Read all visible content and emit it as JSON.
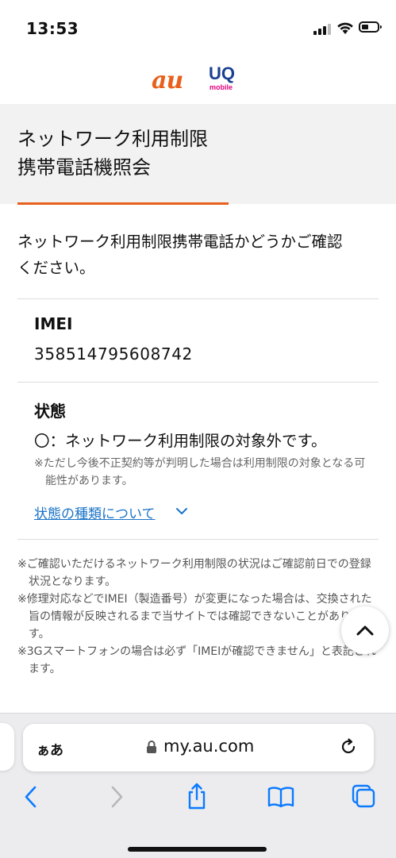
{
  "status_bar": {
    "time": "13:53"
  },
  "logos": {
    "au": "au",
    "uq": "UQ",
    "uq_sub": "mobile"
  },
  "header": {
    "title_line1": "ネットワーク利用制限",
    "title_line2": "携帯電話機照会"
  },
  "intro": {
    "line1": "ネットワーク利用制限携帯電話かどうかご確認",
    "line2": "ください。"
  },
  "imei": {
    "label": "IMEI",
    "value": "358514795608742"
  },
  "status": {
    "label": "状態",
    "value": "〇：ネットワーク利用制限の対象外です。",
    "note": "※ただし今後不正契約等が判明した場合は利用制限の対象となる可能性があります。",
    "types_link": "状態の種類について"
  },
  "notes": [
    "※ご確認いただけるネットワーク利用制限の状況はご確認前日での登録状況となります。",
    "※修理対応などでIMEI（製造番号）が変更になった場合は、交換された旨の情報が反映されるまで当サイトでは確認できないことがあります。",
    "※3Gスマートフォンの場合は必ず「IMEIが確認できません」と表記されます。"
  ],
  "browser": {
    "aa_label": "ぁあ",
    "url": "my.au.com"
  },
  "colors": {
    "accent_orange": "#e8601c",
    "link_blue": "#1a73c8",
    "ios_blue": "#0a7aff"
  }
}
